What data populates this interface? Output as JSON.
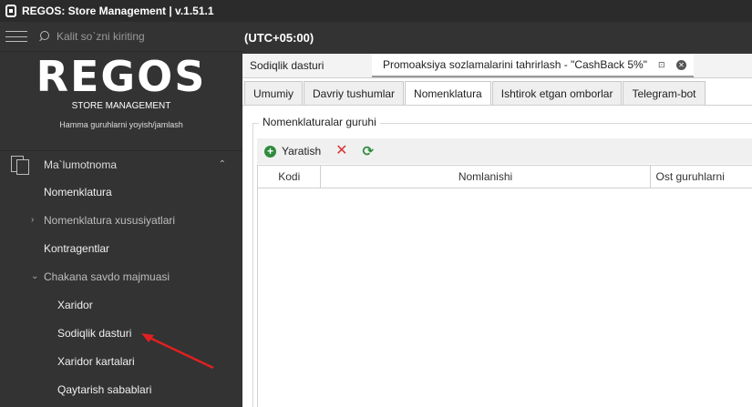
{
  "window": {
    "title": "REGOS: Store Management | v.1.51.1"
  },
  "sidebar": {
    "search_placeholder": "Kalit so`zni kiriting",
    "logo": {
      "text": "REGOS",
      "subtitle": "STORE MANAGEMENT",
      "tagline": "Hamma guruhlarni yoyish/jamlash"
    },
    "section": {
      "label": "Ma`lumotnoma"
    },
    "items": [
      {
        "label": "Nomenklatura"
      },
      {
        "label": "Nomenklatura xususiyatlari"
      },
      {
        "label": "Kontragentlar"
      },
      {
        "label": "Chakana savdo majmuasi"
      },
      {
        "label": "Xaridor"
      },
      {
        "label": "Sodiqlik dasturi"
      },
      {
        "label": "Xaridor kartalari"
      },
      {
        "label": "Qaytarish sabablari"
      }
    ]
  },
  "topbar": {
    "timezone": "(UTC+05:00)"
  },
  "doc_tabs": [
    {
      "label": "Sodiqlik dasturi"
    },
    {
      "label": "Promoaksiya sozlamalarini tahrirlash - \"CashBack 5%\""
    }
  ],
  "sub_tabs": [
    {
      "label": "Umumiy"
    },
    {
      "label": "Davriy tushumlar"
    },
    {
      "label": "Nomenklatura"
    },
    {
      "label": "Ishtirok etgan omborlar"
    },
    {
      "label": "Telegram-bot"
    }
  ],
  "active_sub_tab": "Nomenklatura",
  "group": {
    "title": "Nomenklaturalar guruhi",
    "toolbar": {
      "add_label": "Yaratish"
    },
    "columns": [
      "Kodi",
      "Nomlanishi",
      "Ost guruhlarni"
    ]
  },
  "colors": {
    "accent_red": "#e02020",
    "green": "#2e8b3d",
    "sidebar_bg": "#333333"
  }
}
